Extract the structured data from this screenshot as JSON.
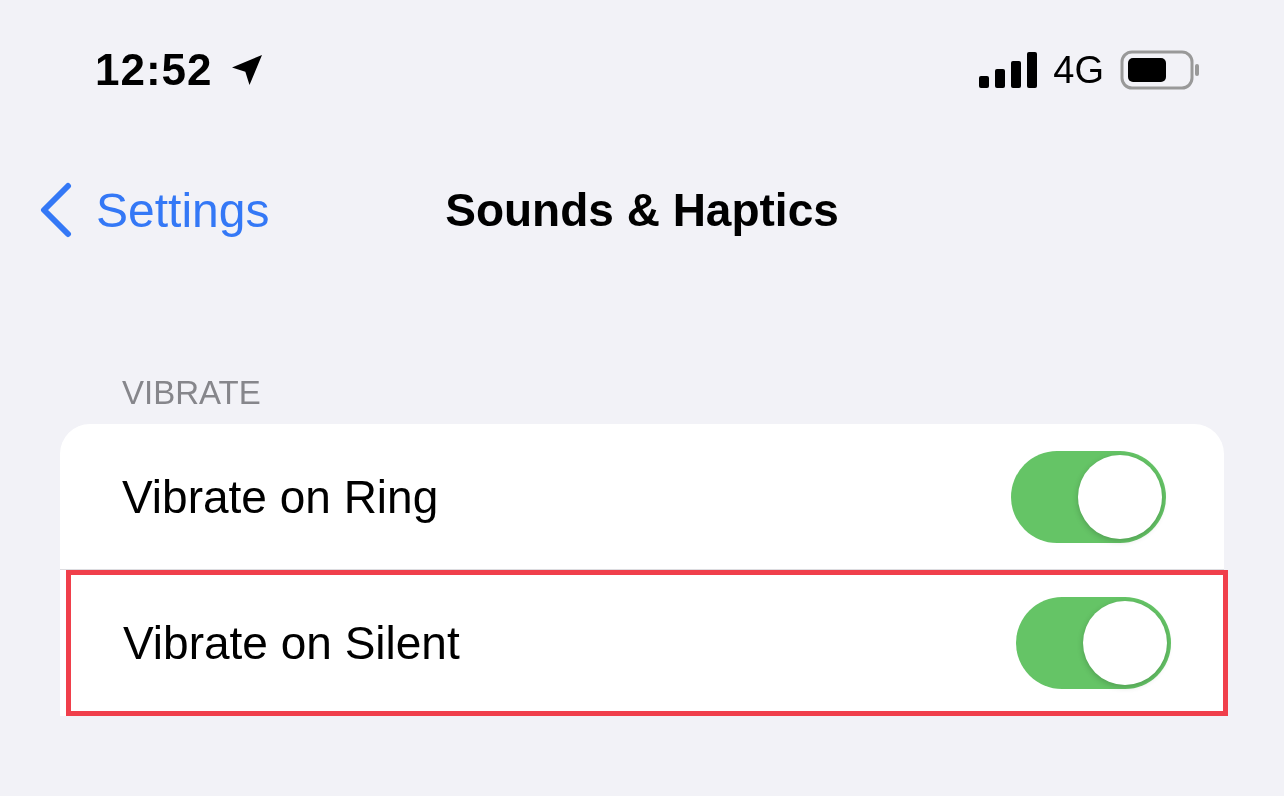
{
  "status_bar": {
    "time": "12:52",
    "location_on": true,
    "network": "4G"
  },
  "nav": {
    "back_label": "Settings",
    "title": "Sounds & Haptics"
  },
  "section": {
    "header": "VIBRATE",
    "rows": [
      {
        "label": "Vibrate on Ring",
        "on": true,
        "highlighted": false
      },
      {
        "label": "Vibrate on Silent",
        "on": true,
        "highlighted": true
      }
    ]
  }
}
